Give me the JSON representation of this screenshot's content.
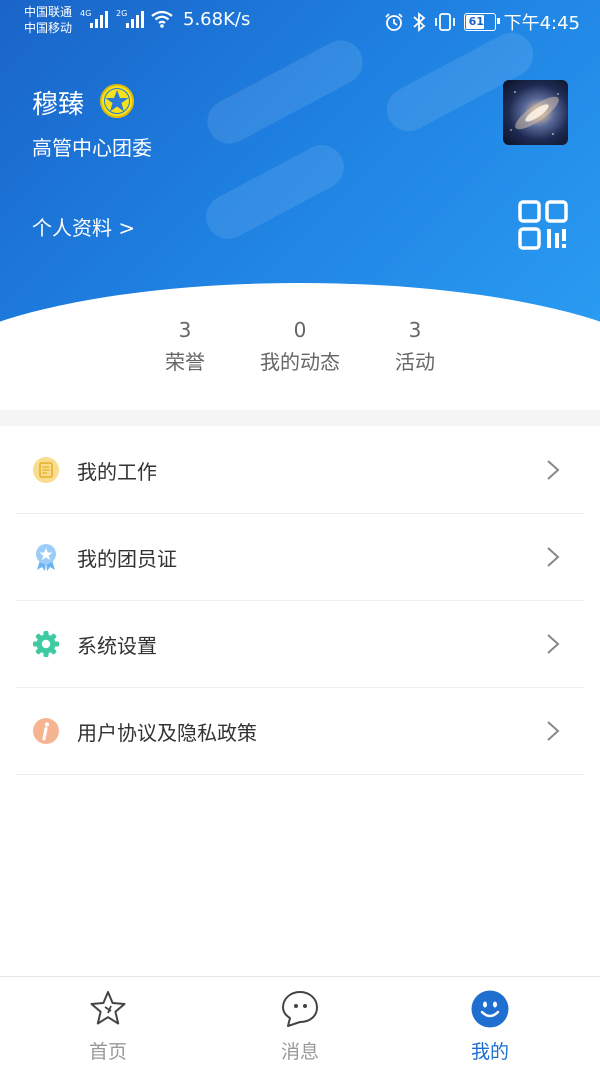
{
  "status_bar": {
    "carrier_1": "中国联通",
    "carrier_2": "中国移动",
    "net_1": "4G",
    "net_2": "2G",
    "speed": "5.68K/s",
    "battery": "61",
    "time": "下午4:45"
  },
  "profile": {
    "name": "穆臻",
    "department": "高管中心团委",
    "profile_link": "个人资料 >"
  },
  "stats": [
    {
      "value": "3",
      "label": "荣誉"
    },
    {
      "value": "0",
      "label": "我的动态"
    },
    {
      "value": "3",
      "label": "活动"
    }
  ],
  "menu": [
    {
      "label": "我的工作",
      "icon": "document-icon",
      "color": "#f5c74e"
    },
    {
      "label": "我的团员证",
      "icon": "ribbon-badge-icon",
      "color": "#6cb4f2"
    },
    {
      "label": "系统设置",
      "icon": "gear-icon",
      "color": "#3ecaa3"
    },
    {
      "label": "用户协议及隐私政策",
      "icon": "info-icon",
      "color": "#f4a071"
    }
  ],
  "tabs": [
    {
      "label": "首页",
      "icon": "star-icon"
    },
    {
      "label": "消息",
      "icon": "chat-bubble-icon"
    },
    {
      "label": "我的",
      "icon": "smiley-face-icon"
    }
  ],
  "colors": {
    "header_start": "#1a64c8",
    "header_end": "#2a9cf2",
    "active_tab": "#1e6fd0",
    "inactive_tab": "#999999"
  }
}
